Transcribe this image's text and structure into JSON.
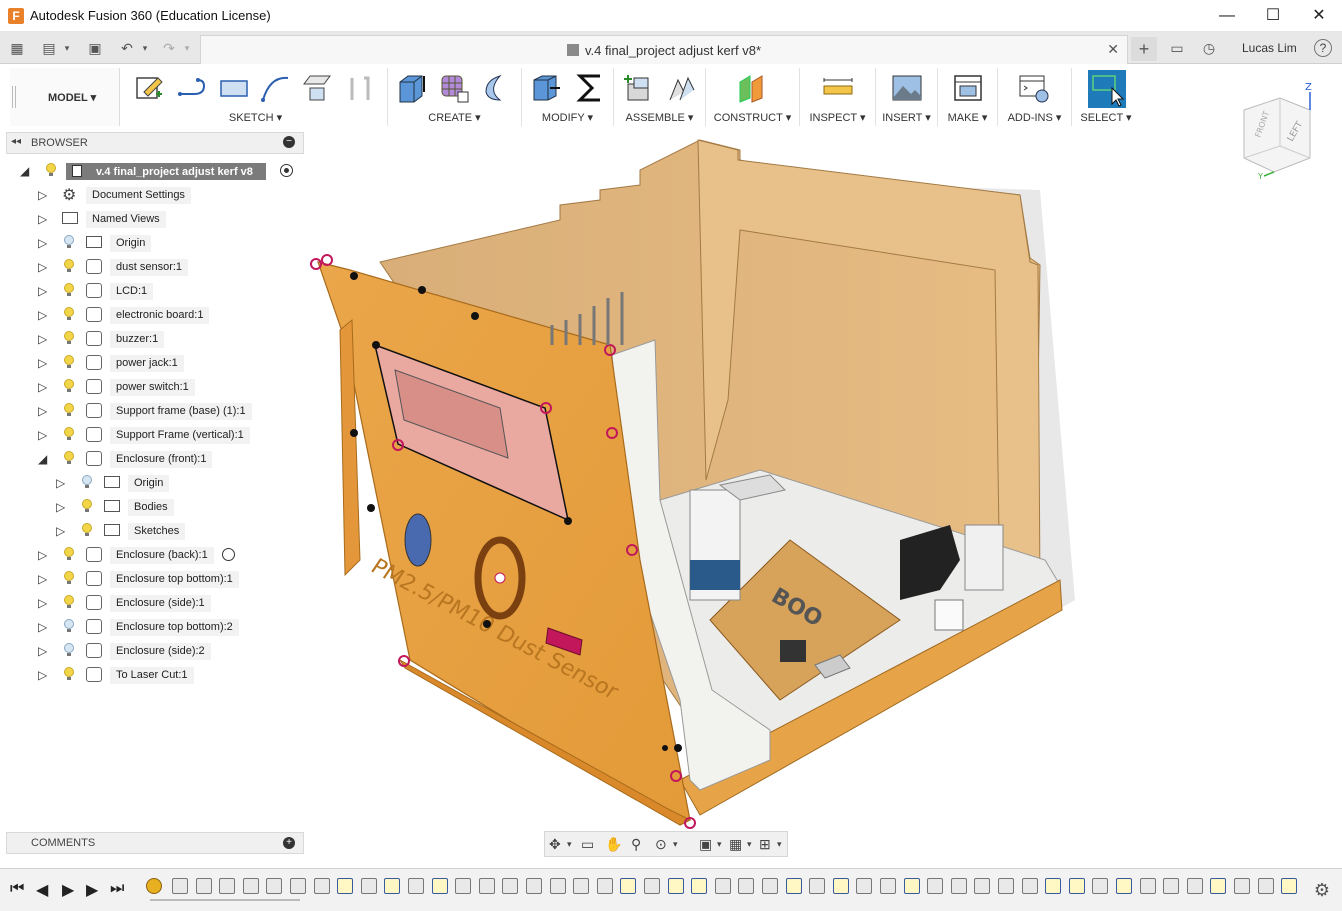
{
  "window": {
    "title": "Autodesk Fusion 360 (Education License)",
    "app_icon": "F",
    "minimize": "—",
    "maximize": "☐",
    "close": "✕"
  },
  "tabbar": {
    "doc_title": "v.4 final_project adjust kerf v8*",
    "user": "Lucas Lim",
    "help": "?",
    "new_tab": "+",
    "close_tab": "✕"
  },
  "toolbar": {
    "workspace": "MODEL ▾",
    "groups": [
      "SKETCH ▾",
      "CREATE ▾",
      "MODIFY ▾",
      "ASSEMBLE ▾",
      "CONSTRUCT ▾",
      "INSPECT ▾",
      "INSERT ▾",
      "MAKE ▾",
      "ADD-INS ▾",
      "SELECT ▾"
    ]
  },
  "browser": {
    "header": "BROWSER",
    "collapse": "◂◂",
    "minus": "−",
    "root": "v.4 final_project adjust kerf v8",
    "items": [
      "Document Settings",
      "Named Views",
      "Origin",
      "dust sensor:1",
      "LCD:1",
      "electronic board:1",
      "buzzer:1",
      "power jack:1",
      "power switch:1",
      "Support frame (base) (1):1",
      "Support Frame (vertical):1",
      "Enclosure (front):1",
      "Origin",
      "Bodies",
      "Sketches",
      "Enclosure (back):1",
      "Enclosure top bottom):1",
      "Enclosure (side):1",
      "Enclosure top bottom):2",
      "Enclosure (side):2",
      "To Laser Cut:1"
    ]
  },
  "comments": {
    "header": "COMMENTS",
    "plus": "+"
  },
  "viewcube": {
    "top": "FRONT",
    "side": "LEFT",
    "axis_z": "Z",
    "axis_y": "Y"
  },
  "model": {
    "engraving": "PM2.5/PM10 Dust Sensor",
    "board_label": "BOO"
  },
  "colors": {
    "accent": "#1e88c8",
    "wood": "#e7a347",
    "wood_light": "#e0b57a",
    "selected_select": "#1e7ab8"
  }
}
